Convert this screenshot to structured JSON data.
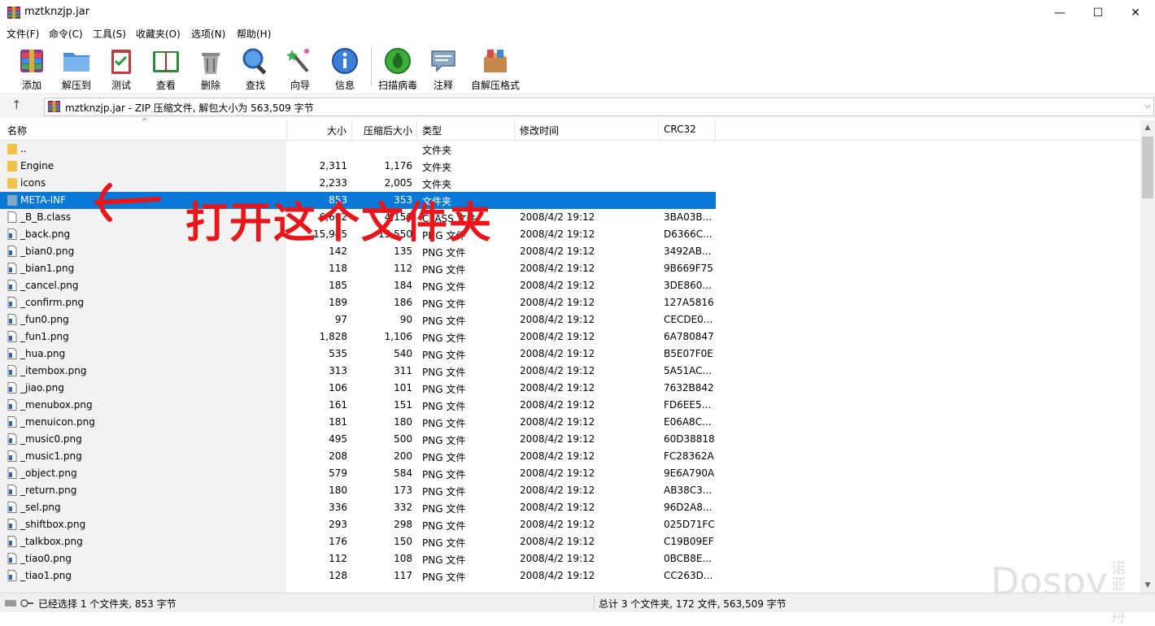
{
  "window": {
    "title": "mztknzjp.jar",
    "minimize": "—",
    "maximize": "☐",
    "close": "✕"
  },
  "menu": [
    "文件(F)",
    "命令(C)",
    "工具(S)",
    "收藏夹(O)",
    "选项(N)",
    "帮助(H)"
  ],
  "toolbar": {
    "add": "添加",
    "extract": "解压到",
    "test": "测试",
    "view": "查看",
    "delete": "删除",
    "find": "查找",
    "wizard": "向导",
    "info": "信息",
    "virus": "扫描病毒",
    "comment": "注释",
    "sfx": "自解压格式"
  },
  "address": {
    "text": "mztknzjp.jar - ZIP 压缩文件, 解包大小为 563,509 字节"
  },
  "columns": {
    "name": "名称",
    "size": "大小",
    "packed": "压缩后大小",
    "type": "类型",
    "modified": "修改时间",
    "crc": "CRC32"
  },
  "rows": [
    {
      "name": "..",
      "size": "",
      "packed": "",
      "type": "文件夹",
      "modified": "",
      "crc": "",
      "icon": "folder"
    },
    {
      "name": "Engine",
      "size": "2,311",
      "packed": "1,176",
      "type": "文件夹",
      "modified": "",
      "crc": "",
      "icon": "folder"
    },
    {
      "name": "icons",
      "size": "2,233",
      "packed": "2,005",
      "type": "文件夹",
      "modified": "",
      "crc": "",
      "icon": "folder"
    },
    {
      "name": "META-INF",
      "size": "853",
      "packed": "353",
      "type": "文件夹",
      "modified": "",
      "crc": "",
      "icon": "folder",
      "selected": true
    },
    {
      "name": "_B_B.class",
      "size": "6,602",
      "packed": "4,156",
      "type": "CLASS 文件",
      "modified": "2008/4/2 19:12",
      "crc": "3BA03B...",
      "icon": "file"
    },
    {
      "name": "_back.png",
      "size": "15,945",
      "packed": "15,550",
      "type": "PNG 文件",
      "modified": "2008/4/2 19:12",
      "crc": "D6366C...",
      "icon": "file"
    },
    {
      "name": "_bian0.png",
      "size": "142",
      "packed": "135",
      "type": "PNG 文件",
      "modified": "2008/4/2 19:12",
      "crc": "3492AB...",
      "icon": "file"
    },
    {
      "name": "_bian1.png",
      "size": "118",
      "packed": "112",
      "type": "PNG 文件",
      "modified": "2008/4/2 19:12",
      "crc": "9B669F75",
      "icon": "file"
    },
    {
      "name": "_cancel.png",
      "size": "185",
      "packed": "184",
      "type": "PNG 文件",
      "modified": "2008/4/2 19:12",
      "crc": "3DE860...",
      "icon": "file"
    },
    {
      "name": "_confirm.png",
      "size": "189",
      "packed": "186",
      "type": "PNG 文件",
      "modified": "2008/4/2 19:12",
      "crc": "127A5816",
      "icon": "file"
    },
    {
      "name": "_fun0.png",
      "size": "97",
      "packed": "90",
      "type": "PNG 文件",
      "modified": "2008/4/2 19:12",
      "crc": "CECDE0...",
      "icon": "file"
    },
    {
      "name": "_fun1.png",
      "size": "1,828",
      "packed": "1,106",
      "type": "PNG 文件",
      "modified": "2008/4/2 19:12",
      "crc": "6A780847",
      "icon": "file"
    },
    {
      "name": "_hua.png",
      "size": "535",
      "packed": "540",
      "type": "PNG 文件",
      "modified": "2008/4/2 19:12",
      "crc": "B5E07F0E",
      "icon": "file"
    },
    {
      "name": "_itembox.png",
      "size": "313",
      "packed": "311",
      "type": "PNG 文件",
      "modified": "2008/4/2 19:12",
      "crc": "5A51AC...",
      "icon": "file"
    },
    {
      "name": "_jiao.png",
      "size": "106",
      "packed": "101",
      "type": "PNG 文件",
      "modified": "2008/4/2 19:12",
      "crc": "7632B842",
      "icon": "file"
    },
    {
      "name": "_menubox.png",
      "size": "161",
      "packed": "151",
      "type": "PNG 文件",
      "modified": "2008/4/2 19:12",
      "crc": "FD6EE5...",
      "icon": "file"
    },
    {
      "name": "_menuicon.png",
      "size": "181",
      "packed": "180",
      "type": "PNG 文件",
      "modified": "2008/4/2 19:12",
      "crc": "E06A8C...",
      "icon": "file"
    },
    {
      "name": "_music0.png",
      "size": "495",
      "packed": "500",
      "type": "PNG 文件",
      "modified": "2008/4/2 19:12",
      "crc": "60D38818",
      "icon": "file"
    },
    {
      "name": "_music1.png",
      "size": "208",
      "packed": "200",
      "type": "PNG 文件",
      "modified": "2008/4/2 19:12",
      "crc": "FC28362A",
      "icon": "file"
    },
    {
      "name": "_object.png",
      "size": "579",
      "packed": "584",
      "type": "PNG 文件",
      "modified": "2008/4/2 19:12",
      "crc": "9E6A790A",
      "icon": "file"
    },
    {
      "name": "_return.png",
      "size": "180",
      "packed": "173",
      "type": "PNG 文件",
      "modified": "2008/4/2 19:12",
      "crc": "AB38C3...",
      "icon": "file"
    },
    {
      "name": "_sel.png",
      "size": "336",
      "packed": "332",
      "type": "PNG 文件",
      "modified": "2008/4/2 19:12",
      "crc": "96D2A8...",
      "icon": "file"
    },
    {
      "name": "_shiftbox.png",
      "size": "293",
      "packed": "298",
      "type": "PNG 文件",
      "modified": "2008/4/2 19:12",
      "crc": "025D71FC",
      "icon": "file"
    },
    {
      "name": "_talkbox.png",
      "size": "176",
      "packed": "150",
      "type": "PNG 文件",
      "modified": "2008/4/2 19:12",
      "crc": "C19B09EF",
      "icon": "file"
    },
    {
      "name": "_tiao0.png",
      "size": "112",
      "packed": "108",
      "type": "PNG 文件",
      "modified": "2008/4/2 19:12",
      "crc": "0BCB8E...",
      "icon": "file"
    },
    {
      "name": "_tiao1.png",
      "size": "128",
      "packed": "117",
      "type": "PNG 文件",
      "modified": "2008/4/2 19:12",
      "crc": "CC263D...",
      "icon": "file"
    }
  ],
  "status": {
    "left": "已经选择 1 个文件夹, 853 字节",
    "right": "总计 3 个文件夹, 172 文件, 563,509 字节"
  },
  "annotation": {
    "text": "打开这个文件夹",
    "color": "#e8161b"
  },
  "watermark": {
    "text": "Dospy",
    "small": "诺亚方舟"
  },
  "colors": {
    "selection": "#0a78d7",
    "name_column_bg": "#f2f2f2",
    "folder": "#f3c04a"
  }
}
